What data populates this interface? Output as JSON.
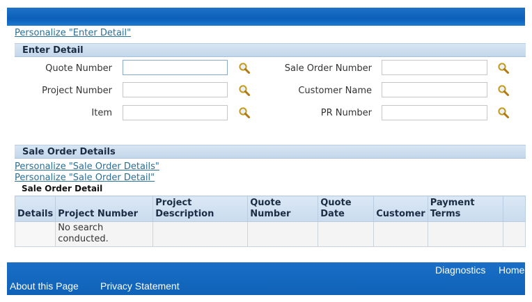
{
  "personalize_enter_detail": "Personalize \"Enter Detail\"",
  "enter_detail": {
    "title": "Enter Detail",
    "fields": {
      "quote_number": {
        "label": "Quote Number",
        "value": ""
      },
      "project_number": {
        "label": "Project Number",
        "value": ""
      },
      "item": {
        "label": "Item",
        "value": ""
      },
      "sale_order_number": {
        "label": "Sale Order Number",
        "value": ""
      },
      "customer_name": {
        "label": "Customer Name",
        "value": ""
      },
      "pr_number": {
        "label": "PR Number",
        "value": ""
      }
    },
    "search_icon": "magnifier-icon"
  },
  "sale_order_details": {
    "title": "Sale Order Details",
    "personalize_links": [
      "Personalize \"Sale Order Details\"",
      "Personalize \"Sale Order Detail\""
    ],
    "subtitle": "Sale Order Detail",
    "columns": [
      "Details",
      "Project Number",
      "Project Description",
      "Quote Number",
      "Quote Date",
      "Customer",
      "Payment Terms"
    ],
    "empty_message": "No search conducted."
  },
  "footer": {
    "diagnostics": "Diagnostics",
    "home": "Home",
    "about": "About this Page",
    "privacy": "Privacy Statement"
  },
  "colors": {
    "brand_blue": "#0b5fb8",
    "header_band": "#c9dbee",
    "link": "#2a6f96"
  }
}
